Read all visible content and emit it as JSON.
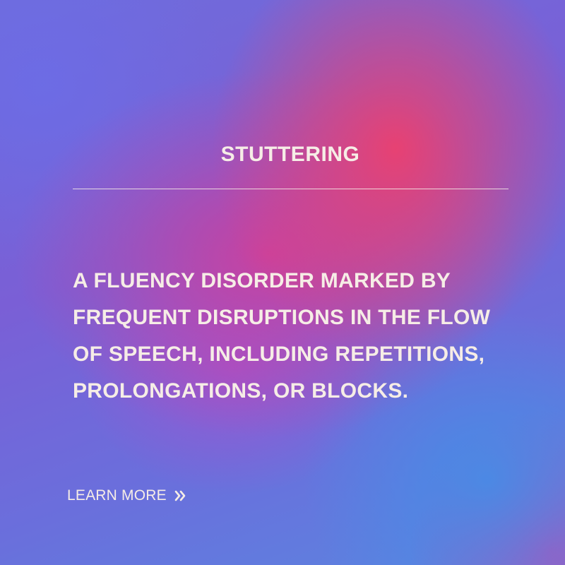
{
  "card": {
    "title": "STUTTERING",
    "description": "A FLUENCY DISORDER MARKED BY FREQUENT DISRUPTIONS IN THE FLOW OF SPEECH, INCLUDING REPETITIONS, PROLONGATIONS, OR BLOCKS.",
    "cta_label": "LEARN MORE",
    "cta_icon": "double-chevron-right-icon"
  },
  "colors": {
    "text": "#f6ede6",
    "gradient_pink": "#ec406e",
    "gradient_purple": "#6f6cdb",
    "gradient_blue": "#468ce6"
  }
}
